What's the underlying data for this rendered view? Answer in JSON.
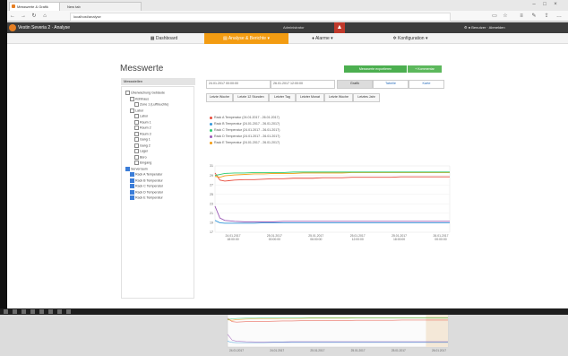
{
  "browser": {
    "tabs": [
      {
        "label": "Messwerte & Grafik"
      },
      {
        "label": "New tab"
      }
    ],
    "url": "localhost/analyse",
    "icons": [
      "back-icon",
      "forward-icon",
      "refresh-icon",
      "home-icon"
    ]
  },
  "app": {
    "title": "Vestin Severia 2 · Analyse",
    "user": "Administrator",
    "right_text": "Benutzer · Abmelden"
  },
  "mainnav": {
    "items": [
      {
        "label": "Dashboard"
      },
      {
        "label": "Analyse & Berichte"
      },
      {
        "label": "Alarme"
      },
      {
        "label": "Konfiguration"
      }
    ]
  },
  "page": {
    "title": "Messwerte",
    "sidebar_header": "Messstellen",
    "btn_export": "Messwerte exportieren",
    "btn_extra": "+ Kommentar",
    "date_from": "24.01.2017 00:00:00",
    "date_to": "26.01.2017 12:00:00",
    "view_tabs": [
      {
        "label": "Grafik"
      },
      {
        "label": "Tabelle"
      },
      {
        "label": "Karte"
      }
    ],
    "range_buttons": [
      "Letzte Woche",
      "Letzte 12 Stunden",
      "Letzter Tag",
      "Letzter Monat",
      "Letzte Woche",
      "Letztes Jahr"
    ]
  },
  "tree": [
    {
      "label": "Überwachung Gebäude",
      "checked": false,
      "indent": 0
    },
    {
      "label": "Kühlhaus",
      "checked": false,
      "indent": 1
    },
    {
      "label": "Zone 1 (Luftfeuchte)",
      "checked": false,
      "indent": 2
    },
    {
      "label": "Labor",
      "checked": false,
      "indent": 1
    },
    {
      "label": "Labor",
      "checked": false,
      "indent": 2
    },
    {
      "label": "Raum 1",
      "checked": false,
      "indent": 2
    },
    {
      "label": "Raum 2",
      "checked": false,
      "indent": 2
    },
    {
      "label": "Raum 3",
      "checked": false,
      "indent": 2
    },
    {
      "label": "Gang 1",
      "checked": false,
      "indent": 2
    },
    {
      "label": "Gang 2",
      "checked": false,
      "indent": 2
    },
    {
      "label": "Lager",
      "checked": false,
      "indent": 2
    },
    {
      "label": "Büro",
      "checked": false,
      "indent": 2
    },
    {
      "label": "Eingang",
      "checked": false,
      "indent": 2
    },
    {
      "label": "Serverraum",
      "checked": true,
      "indent": 0
    },
    {
      "label": "Rack A Temperatur",
      "checked": true,
      "indent": 1
    },
    {
      "label": "Rack B Temperatur",
      "checked": true,
      "indent": 1
    },
    {
      "label": "Rack C Temperatur",
      "checked": true,
      "indent": 1
    },
    {
      "label": "Rack D Temperatur",
      "checked": true,
      "indent": 1
    },
    {
      "label": "Rack E Temperatur",
      "checked": true,
      "indent": 1
    }
  ],
  "legend": [
    {
      "label": "Rack A Temperatur (24.01.2017 - 26.01.2017)",
      "color": "#e74c3c"
    },
    {
      "label": "Rack B Temperatur (24.01.2017 - 26.01.2017)",
      "color": "#3498db"
    },
    {
      "label": "Rack C Temperatur (24.01.2017 - 26.01.2017)",
      "color": "#2ecc71"
    },
    {
      "label": "Rack D Temperatur (24.01.2017 - 26.01.2017)",
      "color": "#9b59b6"
    },
    {
      "label": "Rack E Temperatur (24.01.2017 - 26.01.2017)",
      "color": "#f39c12"
    }
  ],
  "chart_data": {
    "type": "line",
    "title": "",
    "xlabel": "",
    "ylabel": "",
    "ylim": [
      17,
      31
    ],
    "yticks": [
      "31",
      "29",
      "27",
      "25",
      "23",
      "21",
      "19",
      "17"
    ],
    "x_labels": [
      "24.01.2017 18:00:00",
      "25.01.2017 00:00:00",
      "25.01.2017 06:00:00",
      "25.01.2017 12:00:00",
      "25.01.2017 18:00:00",
      "26.01.2017 00:00:00"
    ],
    "x": [
      0,
      0.5,
      1,
      2,
      3,
      4,
      5,
      6,
      7,
      8,
      9,
      10,
      11,
      12,
      13,
      14,
      15,
      16,
      17,
      18,
      19,
      20,
      21,
      22,
      23,
      24
    ],
    "series": [
      {
        "color": "#e74c3c",
        "values": [
          29.5,
          28.0,
          27.8,
          28.0,
          28.1,
          28.1,
          28.2,
          28.3,
          28.3,
          28.4,
          28.4,
          28.4,
          28.5,
          28.5,
          28.5,
          28.6,
          28.6,
          28.6,
          28.6,
          28.6,
          28.7,
          28.7,
          28.7,
          28.7,
          28.7,
          28.7
        ]
      },
      {
        "color": "#f39c12",
        "values": [
          28.8,
          28.6,
          28.9,
          29.1,
          29.2,
          29.3,
          29.3,
          29.4,
          29.4,
          29.4,
          29.5,
          29.5,
          29.5,
          29.5,
          29.5,
          29.6,
          29.6,
          29.6,
          29.6,
          29.6,
          29.6,
          29.6,
          29.6,
          29.6,
          29.6,
          29.6
        ]
      },
      {
        "color": "#2ecc71",
        "values": [
          29.0,
          29.2,
          29.4,
          29.5,
          29.5,
          29.6,
          29.6,
          29.6,
          29.6,
          29.7,
          29.7,
          29.7,
          29.7,
          29.7,
          29.7,
          29.7,
          29.7,
          29.7,
          29.7,
          29.7,
          29.7,
          29.7,
          29.7,
          29.7,
          29.7,
          29.7
        ]
      },
      {
        "color": "#9b59b6",
        "values": [
          22.5,
          20.0,
          19.5,
          19.3,
          19.2,
          19.2,
          19.2,
          19.2,
          19.3,
          19.3,
          19.3,
          19.3,
          19.3,
          19.3,
          19.3,
          19.3,
          19.3,
          19.3,
          19.3,
          19.3,
          19.3,
          19.3,
          19.3,
          19.3,
          19.3,
          19.3
        ]
      },
      {
        "color": "#3498db",
        "values": [
          19.5,
          19.0,
          18.9,
          18.9,
          18.9,
          18.9,
          19.0,
          19.0,
          19.0,
          19.0,
          19.0,
          19.0,
          19.0,
          19.0,
          19.0,
          19.0,
          19.0,
          19.0,
          19.0,
          19.0,
          19.0,
          19.0,
          19.0,
          19.0,
          19.0,
          19.0
        ]
      }
    ],
    "grid": true,
    "legend_position": "top"
  },
  "navigator": {
    "x_labels": [
      "24.01.2017",
      "24.01.2017",
      "25.01.2017",
      "25.01.2017",
      "25.01.2017",
      "26.01.2017"
    ]
  }
}
